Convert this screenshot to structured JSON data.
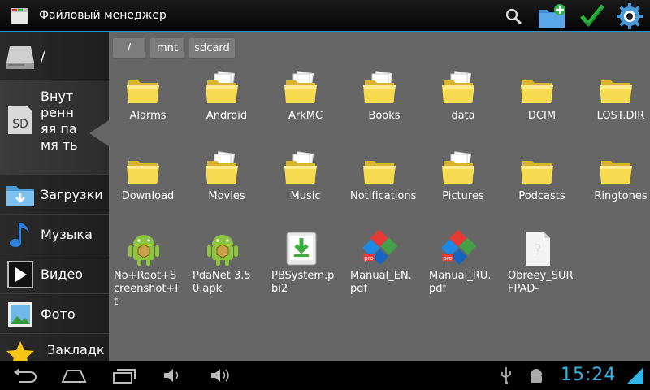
{
  "app": {
    "title": "Файловый менеджер",
    "icon": "file-manager-icon"
  },
  "actions": [
    {
      "name": "search",
      "icon": "search-icon"
    },
    {
      "name": "new-folder",
      "icon": "new-folder-icon"
    },
    {
      "name": "select",
      "icon": "checkmark-icon"
    },
    {
      "name": "settings",
      "icon": "gear-icon"
    }
  ],
  "sidebar": {
    "items": [
      {
        "label": "/",
        "icon": "drive-icon"
      },
      {
        "label": "Внут ренн яя памя ть",
        "icon": "sd-card-icon",
        "active": true
      },
      {
        "label": "Загрузки",
        "icon": "downloads-folder-icon"
      },
      {
        "label": "Музыка",
        "icon": "music-note-icon"
      },
      {
        "label": "Видео",
        "icon": "video-play-icon"
      },
      {
        "label": "Фото",
        "icon": "photo-icon"
      },
      {
        "label": "Закладк",
        "icon": "star-icon"
      }
    ]
  },
  "breadcrumb": [
    "/",
    "mnt",
    "sdcard"
  ],
  "files": [
    {
      "name": "Alarms",
      "type": "folder"
    },
    {
      "name": "Android",
      "type": "folder-docs"
    },
    {
      "name": "ArkMC",
      "type": "folder-docs"
    },
    {
      "name": "Books",
      "type": "folder-docs"
    },
    {
      "name": "data",
      "type": "folder-docs"
    },
    {
      "name": "DCIM",
      "type": "folder"
    },
    {
      "name": "LOST.DIR",
      "type": "folder"
    },
    {
      "name": "Download",
      "type": "folder"
    },
    {
      "name": "Movies",
      "type": "folder-docs"
    },
    {
      "name": "Music",
      "type": "folder-docs"
    },
    {
      "name": "Notifications",
      "type": "folder"
    },
    {
      "name": "Pictures",
      "type": "folder-docs"
    },
    {
      "name": "Podcasts",
      "type": "folder"
    },
    {
      "name": "Ringtones",
      "type": "folder"
    },
    {
      "name": "No+Root+Screenshot+It",
      "type": "apk"
    },
    {
      "name": "PdaNet 3.50.apk",
      "type": "apk"
    },
    {
      "name": "PBSystem.pbi2",
      "type": "install"
    },
    {
      "name": "Manual_EN.pdf",
      "type": "pdf"
    },
    {
      "name": "Manual_RU.pdf",
      "type": "pdf"
    },
    {
      "name": "Obreey_SURFPAD-",
      "type": "unknown"
    }
  ],
  "navbar": {
    "buttons": [
      "back-icon",
      "home-icon",
      "recent-apps-icon",
      "volume-down-icon",
      "volume-up-icon"
    ],
    "status_icons": [
      "usb-icon",
      "android-debug-icon"
    ],
    "time": "15:24",
    "signal_icon": "wifi-signal-icon"
  },
  "colors": {
    "accent": "#33b5e5",
    "folder": "#f2d24a",
    "main_bg": "#666666"
  }
}
